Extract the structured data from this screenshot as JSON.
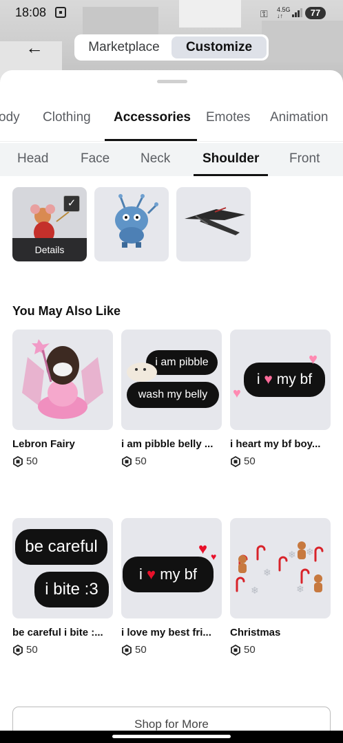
{
  "status": {
    "time": "18:08",
    "net": "4.5G",
    "battery": "77"
  },
  "header": {
    "back_icon": "back-arrow-icon",
    "segments": [
      "Marketplace",
      "Customize"
    ],
    "active_segment": "Customize"
  },
  "tabs": [
    "ody",
    "Clothing",
    "Accessories",
    "Emotes",
    "Animation"
  ],
  "active_tab": "Accessories",
  "subtabs": [
    "Head",
    "Face",
    "Neck",
    "Shoulder",
    "Front"
  ],
  "active_subtab": "Shoulder",
  "equipped": {
    "details_label": "Details"
  },
  "recommend": {
    "title": "You May Also Like",
    "items": [
      {
        "name": "Lebron Fairy",
        "price": "50"
      },
      {
        "name": "i am pibble belly ...",
        "price": "50",
        "text1": "i am pibble",
        "text2": "wash my belly"
      },
      {
        "name": "i heart my bf boy...",
        "price": "50",
        "text1": "i",
        "text2": "my bf"
      },
      {
        "name": "be careful i bite :...",
        "price": "50",
        "text1": "be careful",
        "text2": "i bite :3"
      },
      {
        "name": "i love my best fri...",
        "price": "50",
        "text1": "i",
        "text2": "my bf"
      },
      {
        "name": "Christmas",
        "price": "50"
      }
    ]
  },
  "shop_more_label": "Shop for More",
  "colors": {
    "accent": "#111111",
    "card_bg": "#e6e7ec",
    "heart": "#e8102a"
  }
}
